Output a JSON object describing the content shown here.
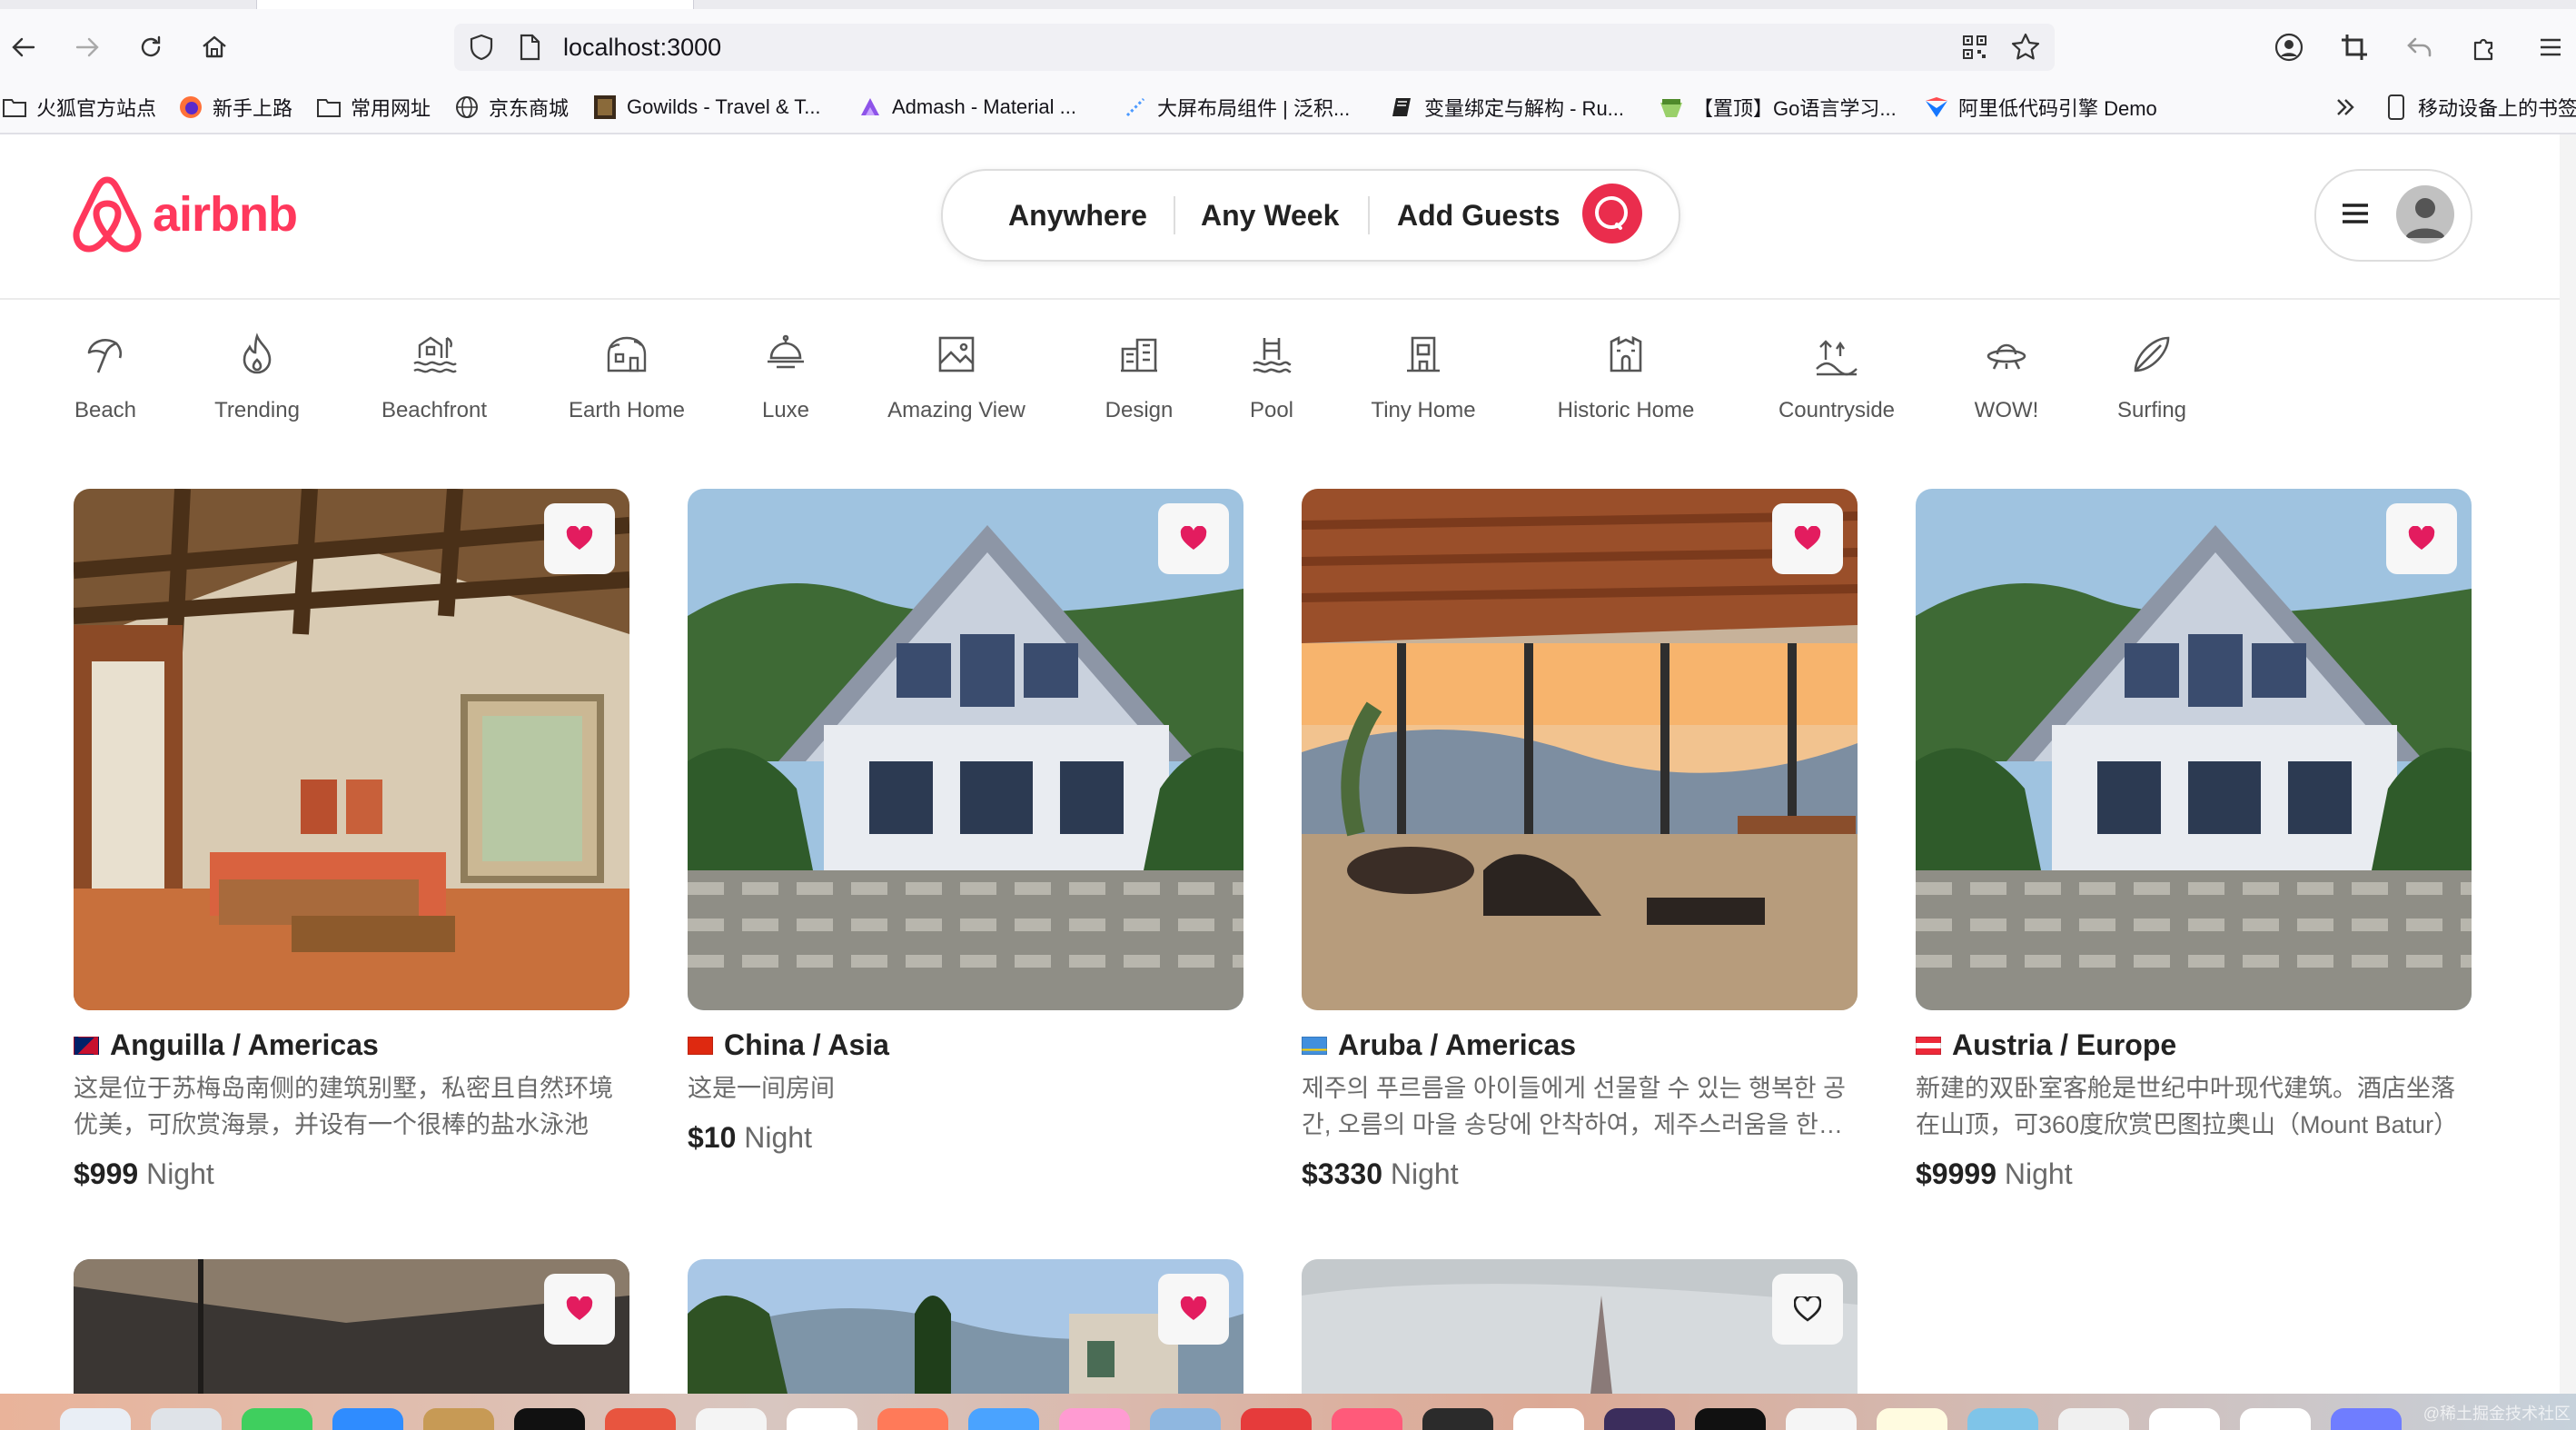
{
  "browser": {
    "url": "localhost:3000",
    "bookmarks": [
      {
        "label": "火狐官方站点",
        "icon": "folder-icon"
      },
      {
        "label": "新手上路",
        "icon": "firefox-icon"
      },
      {
        "label": "常用网址",
        "icon": "folder-icon"
      },
      {
        "label": "京东商城",
        "icon": "globe-icon"
      },
      {
        "label": "Gowilds - Travel & T...",
        "icon": "site-thumb-icon"
      },
      {
        "label": "Admash - Material ...",
        "icon": "admash-icon"
      },
      {
        "label": "大屏布局组件 | 泛积...",
        "icon": "dotted-icon"
      },
      {
        "label": "变量绑定与解构 - Ru...",
        "icon": "book-icon"
      },
      {
        "label": "【置顶】Go语言学习...",
        "icon": "go-icon"
      },
      {
        "label": "阿里低代码引擎 Demo",
        "icon": "lowcode-icon"
      }
    ],
    "mobile_bookmarks": "移动设备上的书签"
  },
  "header": {
    "logo_text": "airbnb",
    "search": {
      "anywhere": "Anywhere",
      "any_week": "Any Week",
      "add_guests": "Add Guests"
    }
  },
  "categories": [
    {
      "label": "Beach",
      "icon": "beach-umbrella-icon"
    },
    {
      "label": "Trending",
      "icon": "fire-icon"
    },
    {
      "label": "Beachfront",
      "icon": "beachfront-icon"
    },
    {
      "label": "Earth Home",
      "icon": "earth-home-icon"
    },
    {
      "label": "Luxe",
      "icon": "luxe-icon"
    },
    {
      "label": "Amazing View",
      "icon": "amazing-view-icon"
    },
    {
      "label": "Design",
      "icon": "design-icon"
    },
    {
      "label": "Pool",
      "icon": "pool-icon"
    },
    {
      "label": "Tiny Home",
      "icon": "tiny-home-icon"
    },
    {
      "label": "Historic Home",
      "icon": "historic-home-icon"
    },
    {
      "label": "Countryside",
      "icon": "countryside-icon"
    },
    {
      "label": "WOW!",
      "icon": "ufo-icon"
    },
    {
      "label": "Surfing",
      "icon": "surfboard-icon"
    }
  ],
  "listings": [
    {
      "location": "Anguilla / Americas",
      "description": "这是位于苏梅岛南侧的建筑别墅，私密且自然环境优美，可欣赏海景，并设有一个很棒的盐水泳池",
      "price": "$999",
      "unit": "Night",
      "favorited": true,
      "flag_colors": [
        "#012169",
        "#c8102e"
      ]
    },
    {
      "location": "China / Asia",
      "description": "这是一间房间",
      "price": "$10",
      "unit": "Night",
      "favorited": true,
      "flag_colors": [
        "#de2910",
        "#ffde00"
      ]
    },
    {
      "location": "Aruba / Americas",
      "description": "제주의 푸르름을 아이들에게 선물할 수 있는 행복한 공간, 오름의 마을 송당에 안착하여，제주스러움을 한껏 느낄 수 있는 곳",
      "price": "$3330",
      "unit": "Night",
      "favorited": false,
      "flag_colors": [
        "#418fde",
        "#ffd100"
      ]
    },
    {
      "location": "Austria / Europe",
      "description": "新建的双卧室客舱是世纪中叶现代建筑。酒店坐落在山顶，可360度欣赏巴图拉奥山（Mount Batur）",
      "price": "$9999",
      "unit": "Night",
      "favorited": true,
      "flag_colors": [
        "#ed2939",
        "#ffffff"
      ]
    },
    {
      "favorited": true
    },
    {
      "favorited": true
    },
    {
      "favorited": false
    }
  ],
  "colors": {
    "brand": "#ff385c",
    "search_button": "#ea2d4d",
    "heart": "#e31c5f"
  },
  "watermark": "@稀土掘金技术社区"
}
